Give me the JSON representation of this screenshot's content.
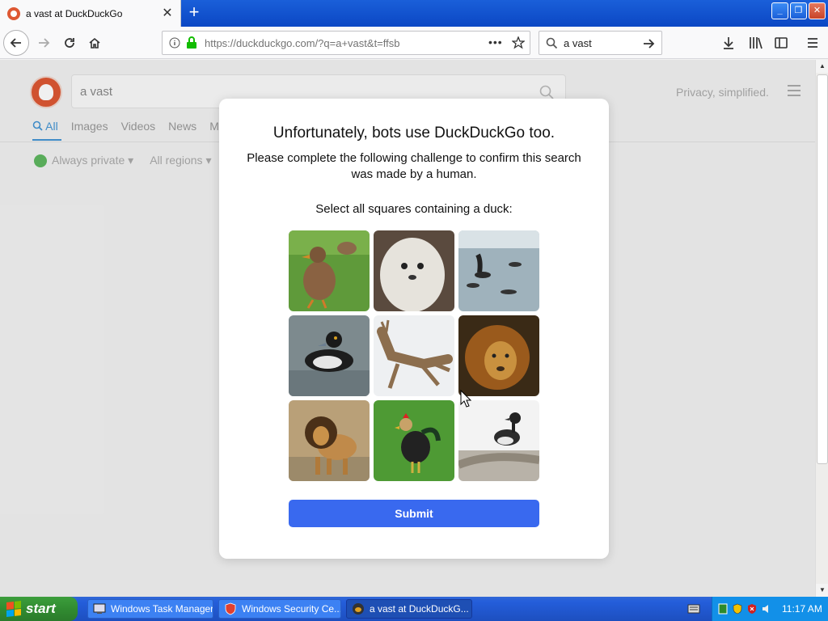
{
  "browser": {
    "tab_title": "a vast at DuckDuckGo",
    "url": "https://duckduckgo.com/?q=a+vast&t=ffsb",
    "search_value": "a vast"
  },
  "page": {
    "search_value": "a vast",
    "privacy_text": "Privacy, simplified.",
    "nav_tabs": [
      "All",
      "Images",
      "Videos",
      "News",
      "M"
    ],
    "filters": [
      "Always private",
      "All regions"
    ]
  },
  "captcha": {
    "title": "Unfortunately, bots use DuckDuckGo too.",
    "subtitle": "Please complete the following challenge to confirm this search was made by a human.",
    "prompt": "Select all squares containing a duck:",
    "tiles": [
      "duck",
      "seal",
      "penguins",
      "duck",
      "deer",
      "lion",
      "lion",
      "rooster",
      "duck"
    ],
    "submit_label": "Submit"
  },
  "taskbar": {
    "start_label": "start",
    "tasks": [
      "Windows Task Manager",
      "Windows Security Ce...",
      "a vast at DuckDuckG..."
    ],
    "clock": "11:17 AM"
  }
}
